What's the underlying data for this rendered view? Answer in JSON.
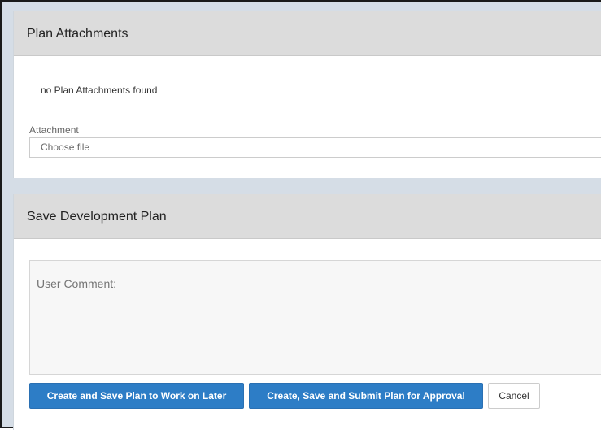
{
  "attachments": {
    "title": "Plan Attachments",
    "empty_message": "no Plan Attachments found",
    "field_label": "Attachment",
    "file_placeholder": "Choose file"
  },
  "save": {
    "title": "Save Development Plan",
    "comment_placeholder": "User Comment:",
    "buttons": {
      "save_later": "Create and Save Plan to Work on Later",
      "submit": "Create, Save and Submit Plan for Approval",
      "cancel": "Cancel"
    }
  },
  "colors": {
    "primary": "#2d7dc6",
    "header_bg": "#dcdcdc",
    "page_bg": "#d5dde6"
  }
}
